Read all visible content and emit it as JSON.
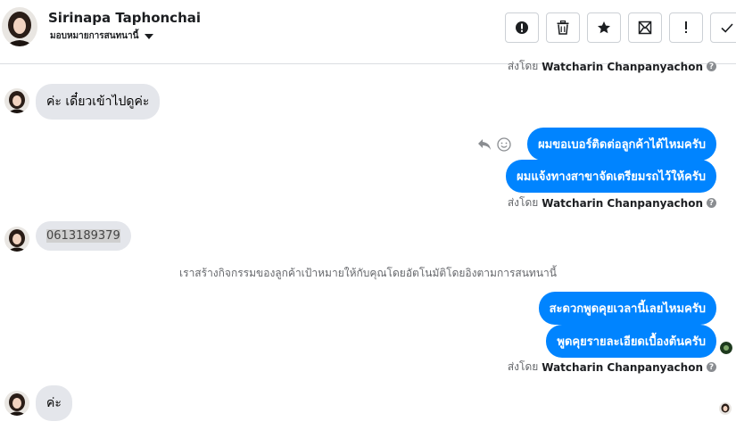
{
  "header": {
    "name": "Sirinapa Taphonchai",
    "assign_label": "มอบหมายการสนทนานี้"
  },
  "toolbar": {
    "icons": [
      "alert-circle-icon",
      "trash-icon",
      "star-icon",
      "mark-unread-icon",
      "important-icon",
      "check-icon"
    ]
  },
  "messages": {
    "sent_by_prefix": "ส่งโดย",
    "agent_name": "Watcharin Chanpanyachon",
    "in_1": "ค่ะ เดี๋ยวเข้าไปดูค่ะ",
    "out_1": "ผมขอเบอร์ติดต่อลูกค้าได้ไหมครับ",
    "out_2": "ผมแจ้งทางสาขาจัดเตรียมรถไว้ให้ครับ",
    "in_2": "0613189379",
    "system_note": "เราสร้างกิจกรรมของลูกค้าเป้าหมายให้กับคุณโดยอัตโนมัติโดยอิงตามการสนทนานี้",
    "out_3": "สะดวกพูดคุยเวลานี้เลยไหมครับ",
    "out_4": "พูดคุยรายละเอียดเบื้องต้นครับ",
    "in_3": "ค่ะ"
  },
  "colors": {
    "outgoing_bubble": "#0084ff",
    "incoming_bubble": "#e4e6eb"
  }
}
